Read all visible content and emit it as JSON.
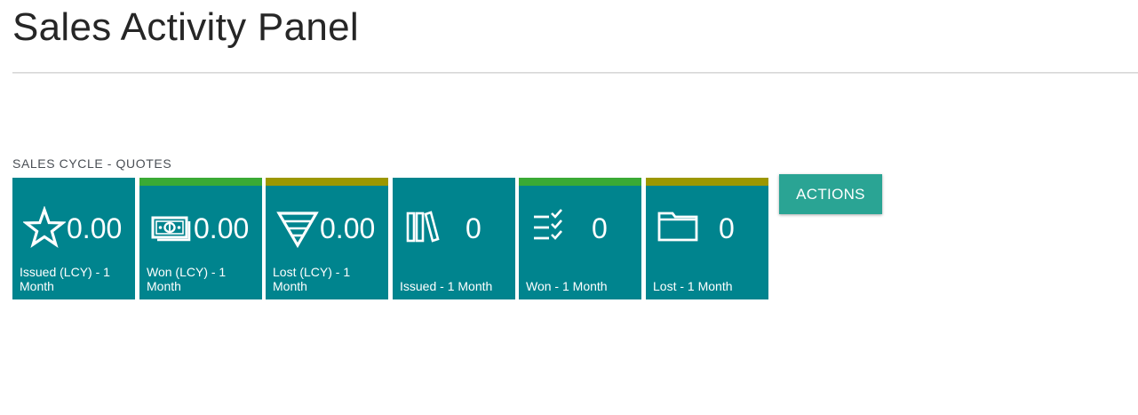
{
  "page": {
    "title": "Sales Activity Panel"
  },
  "section": {
    "label": "SALES CYCLE - QUOTES"
  },
  "tiles": [
    {
      "value": "0.00",
      "label": "Issued (LCY) - 1 Month",
      "icon": "star-icon",
      "bar_color": ""
    },
    {
      "value": "0.00",
      "label": "Won (LCY) - 1 Month",
      "icon": "money-icon",
      "bar_color": "#3aaa35"
    },
    {
      "value": "0.00",
      "label": "Lost (LCY) - 1 Month",
      "icon": "funnel-icon",
      "bar_color": "#9c9700"
    },
    {
      "value": "0",
      "label": "Issued - 1 Month",
      "icon": "books-icon",
      "bar_color": ""
    },
    {
      "value": "0",
      "label": "Won - 1 Month",
      "icon": "checklist-icon",
      "bar_color": "#3aaa35"
    },
    {
      "value": "0",
      "label": "Lost - 1 Month",
      "icon": "folder-icon",
      "bar_color": "#9c9700"
    }
  ],
  "actions": {
    "label": "ACTIONS"
  },
  "colors": {
    "tile_bg": "#00848e",
    "actions_bg": "#2aa494"
  }
}
